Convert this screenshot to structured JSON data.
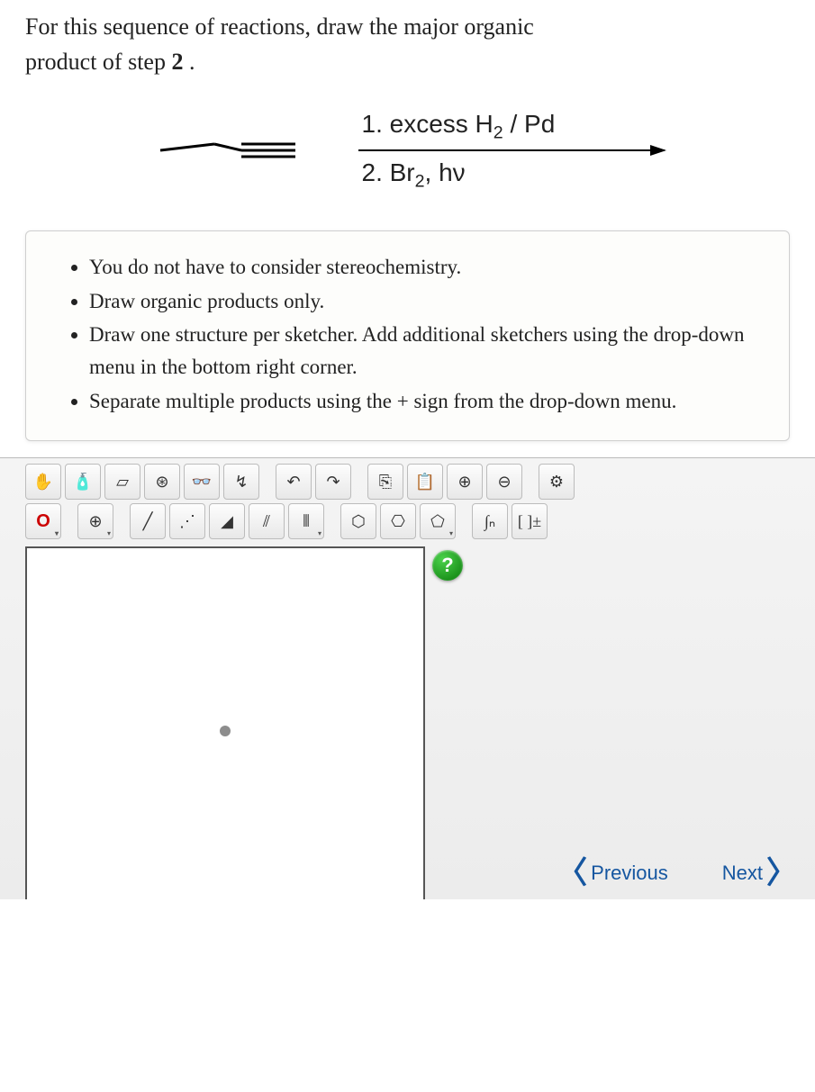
{
  "question": {
    "line1": "For this sequence of reactions, draw the major organic",
    "line2_prefix": "product of step ",
    "line2_step": "2",
    "line2_suffix": " ."
  },
  "reaction": {
    "starting_material": "1-butyne (but-1-yne) line structure",
    "condition1_prefix": "1. excess H",
    "condition1_sub": "2",
    "condition1_suffix": " / Pd",
    "condition2_prefix": "2. Br",
    "condition2_sub": "2",
    "condition2_suffix": ", hν"
  },
  "instructions": {
    "items": [
      "You do not have to consider stereochemistry.",
      "Draw organic products only.",
      "Draw one structure per sketcher. Add additional sketchers using the drop-down menu in the bottom right corner.",
      "Separate multiple products using the + sign from the drop-down menu."
    ]
  },
  "toolbar": {
    "row1": [
      {
        "name": "move-tool",
        "label": "✋"
      },
      {
        "name": "spray-tool",
        "label": "🧴"
      },
      {
        "name": "eraser-tool",
        "label": "▱"
      },
      {
        "name": "snowflake-tool",
        "label": "⊛"
      },
      {
        "name": "glasses-tool",
        "label": "👓"
      },
      {
        "name": "clean-tool",
        "label": "↯"
      },
      {
        "name": "gap1",
        "gap": true
      },
      {
        "name": "undo-tool",
        "label": "↶"
      },
      {
        "name": "redo-tool",
        "label": "↷"
      },
      {
        "name": "gap2",
        "gap": true
      },
      {
        "name": "copy-tool",
        "label": "⎘"
      },
      {
        "name": "paste-tool",
        "label": "📋"
      },
      {
        "name": "zoom-in-tool",
        "label": "⊕"
      },
      {
        "name": "zoom-out-tool",
        "label": "⊖"
      },
      {
        "name": "gap3",
        "gap": true
      },
      {
        "name": "settings-tool",
        "label": "⚙"
      }
    ],
    "row2": [
      {
        "name": "atom-oxygen",
        "label": "O",
        "atom": true,
        "caret": true
      },
      {
        "name": "gap4",
        "gap": true
      },
      {
        "name": "charge-tool",
        "label": "⊕",
        "caret": true
      },
      {
        "name": "gap5",
        "gap": true
      },
      {
        "name": "single-bond",
        "label": "╱"
      },
      {
        "name": "dashed-bond",
        "label": "⋰"
      },
      {
        "name": "wedge-bond",
        "label": "◢"
      },
      {
        "name": "double-bond",
        "label": "⫽"
      },
      {
        "name": "triple-bond",
        "label": "⫴",
        "caret": true
      },
      {
        "name": "gap6",
        "gap": true
      },
      {
        "name": "ring-cyclohexane",
        "label": "⬡"
      },
      {
        "name": "ring-benzene",
        "label": "⎔"
      },
      {
        "name": "ring-other",
        "label": "⬠",
        "caret": true
      },
      {
        "name": "gap7",
        "gap": true
      },
      {
        "name": "chain-tool",
        "label": "∫ₙ"
      },
      {
        "name": "bracket-tool",
        "label": "[ ]±"
      }
    ]
  },
  "help": {
    "label": "?"
  },
  "nav": {
    "previous": "Previous",
    "next": "Next"
  }
}
